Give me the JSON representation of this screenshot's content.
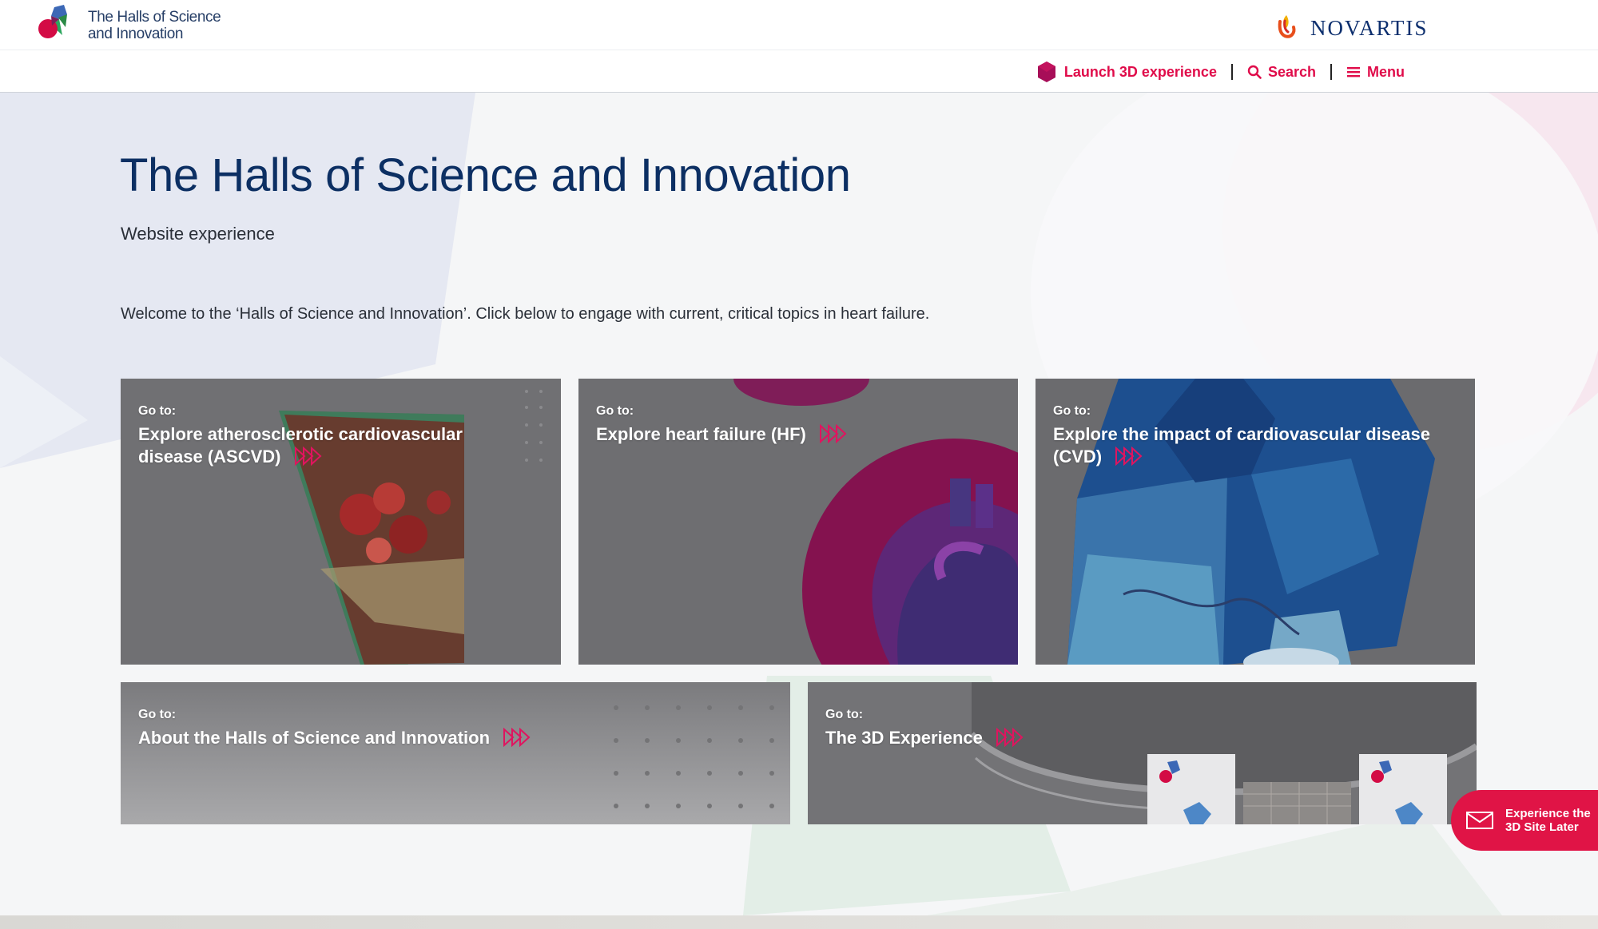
{
  "header": {
    "brand_line1": "The Halls of Science",
    "brand_line2": "and Innovation",
    "partner": "NOVARTIS",
    "launch": "Launch 3D experience",
    "search": "Search",
    "menu": "Menu"
  },
  "main": {
    "title": "The Halls of Science and Innovation",
    "subtitle": "Website experience",
    "intro": "Welcome to the ‘Halls of Science and Innovation’. Click below to engage with current, critical topics in heart failure."
  },
  "cards": [
    {
      "go": "Go to:",
      "line1": "Explore atherosclerotic cardiovascular",
      "line2": "disease (ASCVD)"
    },
    {
      "go": "Go to:",
      "line1": "Explore heart failure (HF)",
      "line2": ""
    },
    {
      "go": "Go to:",
      "line1": "Explore the impact of cardiovascular disease",
      "line2": "(CVD)"
    },
    {
      "go": "Go to:",
      "line1": "About the Halls of Science and Innovation",
      "line2": ""
    },
    {
      "go": "Go to:",
      "line1": "The 3D Experience",
      "line2": ""
    }
  ],
  "floating": {
    "line1": "Experience the",
    "line2": "3D Site Later"
  },
  "colors": {
    "accent": "#e00c4a",
    "title": "#0c2f63",
    "card": "#6d6d70"
  }
}
